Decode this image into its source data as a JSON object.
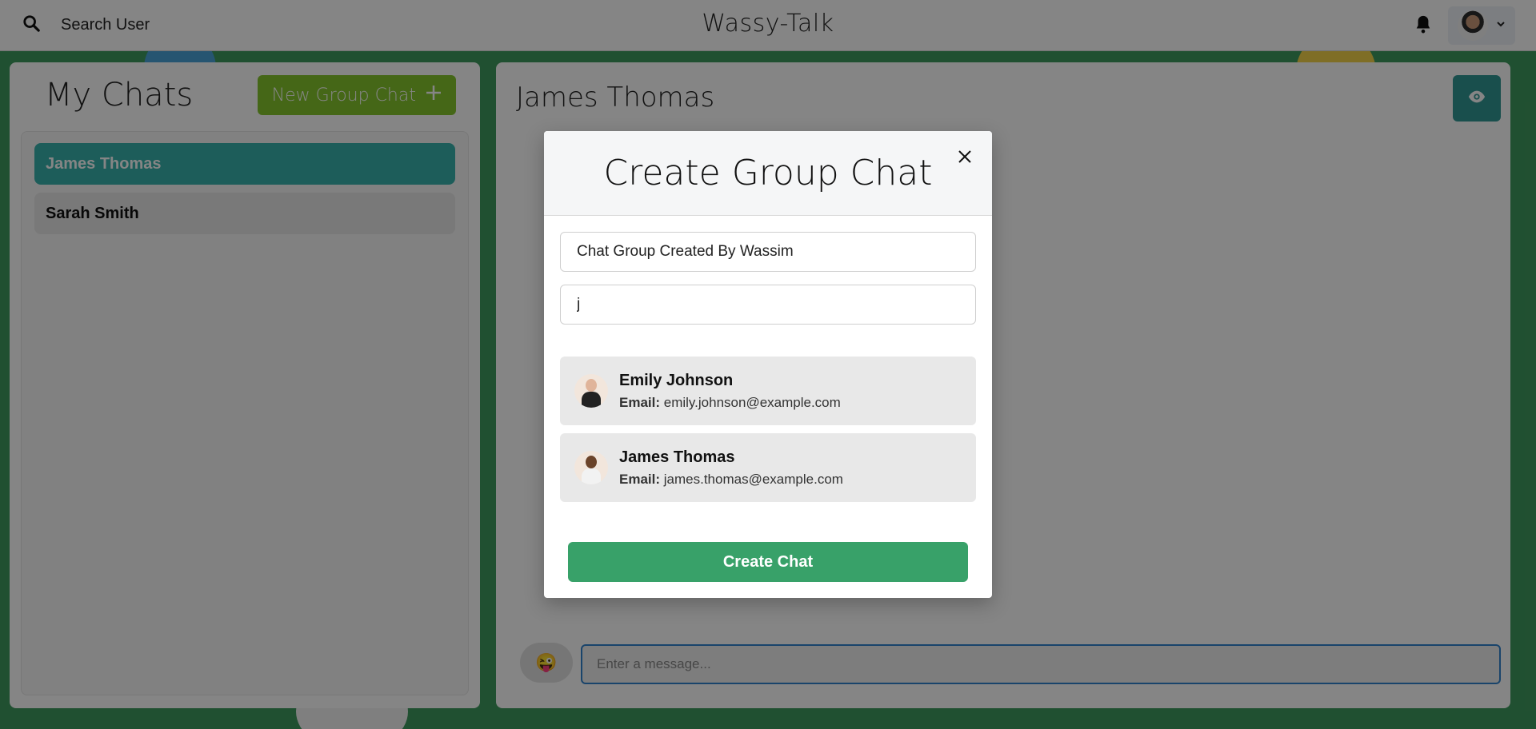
{
  "header": {
    "search_label": "Search User",
    "app_title": "Wassy-Talk"
  },
  "sidebar": {
    "title": "My Chats",
    "new_group_label": "New Group Chat",
    "chats": [
      {
        "name": "James Thomas",
        "active": true
      },
      {
        "name": "Sarah Smith",
        "active": false
      }
    ]
  },
  "chat": {
    "title": "James Thomas",
    "message_placeholder": "Enter a message..."
  },
  "modal": {
    "title": "Create Group Chat",
    "group_name_value": "Chat Group Created By Wassim",
    "search_value": "j",
    "email_label": "Email:",
    "results": [
      {
        "name": "Emily Johnson",
        "email": "emily.johnson@example.com"
      },
      {
        "name": "James Thomas",
        "email": "james.thomas@example.com"
      }
    ],
    "create_label": "Create Chat"
  },
  "colors": {
    "accent_teal": "#38b2ac",
    "new_group_green": "#84c62c",
    "create_green": "#38a169",
    "input_focus_blue": "#3182ce"
  }
}
